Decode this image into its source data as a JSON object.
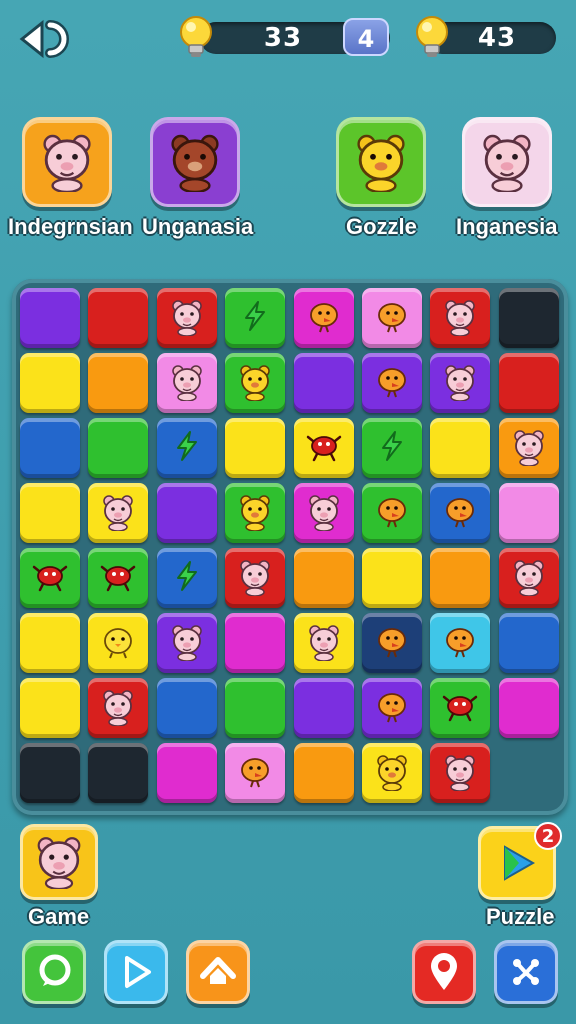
{
  "header": {
    "hints_value": "33",
    "level_value": "4",
    "score_value": "43"
  },
  "characters": [
    {
      "label": "Indegrnsian",
      "color": "#f6a21c",
      "face": "pig"
    },
    {
      "label": "Unganasia",
      "color": "#8a3fd1",
      "face": "bear"
    },
    {
      "label": "Gozzle",
      "color": "#5cc52a",
      "face": "bear-yellow"
    },
    {
      "label": "Inganesia",
      "color": "#f4d6ea",
      "face": "pig"
    }
  ],
  "board": {
    "rows": [
      [
        "purple",
        "red",
        "red:pig",
        "green:bolt",
        "magenta:bird",
        "pink:bird",
        "red:pig",
        "dark"
      ],
      [
        "yellow",
        "orange",
        "pink:pig",
        "green:bear",
        "purple",
        "purple:bird",
        "purple:pig",
        "red"
      ],
      [
        "blue",
        "green",
        "blue:bolt",
        "yellow",
        "yellow:crab",
        "green:bolt",
        "yellow",
        "orange:pig"
      ],
      [
        "yellow",
        "yellow:pig",
        "purple",
        "green:bear",
        "magenta:pig",
        "green:bird",
        "blue:bird",
        "pink"
      ],
      [
        "green:crab",
        "green:crab",
        "blue:bolt",
        "red:pig",
        "orange",
        "yellow",
        "orange",
        "red:pig"
      ],
      [
        "yellow",
        "yellow:chick",
        "purple:pig",
        "magenta",
        "yellow:pig",
        "navy:bird",
        "cyan:bird",
        "blue"
      ],
      [
        "yellow",
        "red:pig",
        "blue",
        "green",
        "purple",
        "purple:bird",
        "green:crab",
        "magenta"
      ],
      [
        "dark",
        "dark",
        "magenta",
        "pink:bird",
        "orange",
        "yellow:bear",
        "red:pig",
        ""
      ]
    ],
    "colors": {
      "purple": "#7b2fe0",
      "red": "#d8201e",
      "green": "#2fc02f",
      "magenta": "#e02ccf",
      "pink": "#f28ae6",
      "yellow": "#fbe21a",
      "orange": "#f99a10",
      "blue": "#2367cc",
      "dark": "#1e2730",
      "navy": "#1d3f78",
      "cyan": "#3fc6e8"
    }
  },
  "bottom": {
    "game_label": "Game",
    "puzzle_label": "Puzzle",
    "puzzle_badge": "2"
  }
}
